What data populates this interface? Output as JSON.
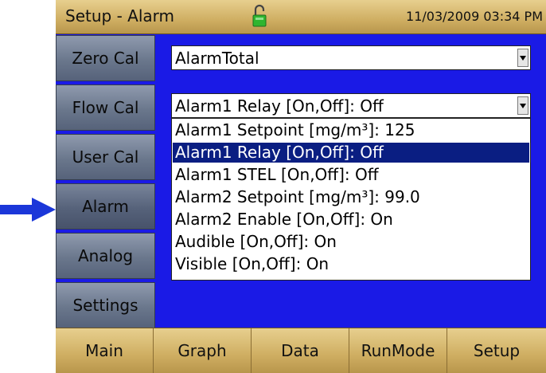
{
  "titlebar": {
    "title": "Setup - Alarm",
    "datetime": "11/03/2009 03:34 PM",
    "lock_icon": "unlock-icon"
  },
  "sidebar": {
    "items": [
      {
        "label": "Zero Cal"
      },
      {
        "label": "Flow Cal"
      },
      {
        "label": "User Cal"
      },
      {
        "label": "Alarm",
        "active": true
      },
      {
        "label": "Analog"
      },
      {
        "label": "Settings"
      }
    ]
  },
  "alarm_select": {
    "value": "AlarmTotal"
  },
  "parameter_select": {
    "value": "Alarm1 Relay [On,Off]: Off",
    "options": [
      "Alarm1 Setpoint [mg/m³]: 125",
      "Alarm1 Relay [On,Off]: Off",
      "Alarm1 STEL [On,Off]: Off",
      "Alarm2 Setpoint [mg/m³]: 99.0",
      "Alarm2 Enable [On,Off]: On",
      "Audible [On,Off]: On",
      "Visible [On,Off]: On"
    ],
    "selected_index": 1
  },
  "bottombar": {
    "items": [
      {
        "label": "Main"
      },
      {
        "label": "Graph"
      },
      {
        "label": "Data"
      },
      {
        "label": "RunMode"
      },
      {
        "label": "Setup"
      }
    ]
  },
  "annotation": {
    "arrow_icon": "arrow-right-icon",
    "arrow_color": "#1b37d9"
  },
  "colors": {
    "background": "#1a1ae6",
    "accent_bar": "#cfae62",
    "selection": "#0a1e82"
  }
}
